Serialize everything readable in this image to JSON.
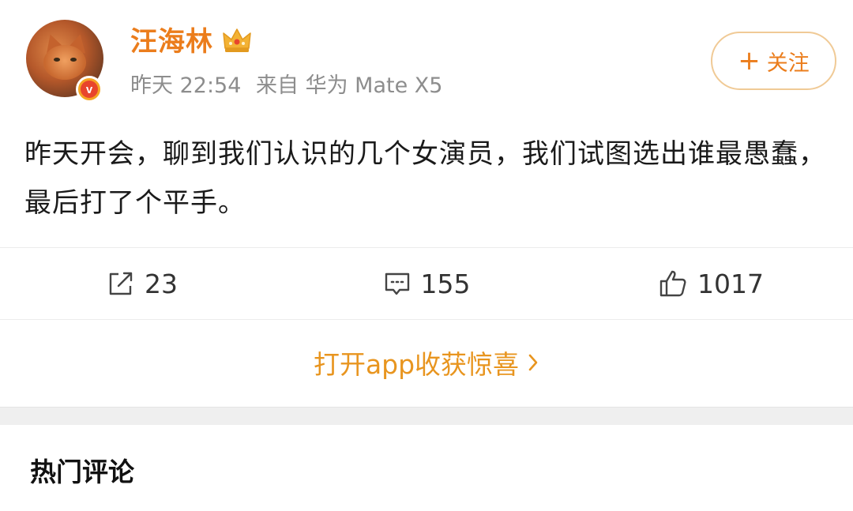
{
  "user": {
    "name": "汪海林",
    "badge_letter": "v"
  },
  "meta": {
    "time": "昨天 22:54",
    "source": "来自 华为 Mate X5"
  },
  "follow": {
    "label": "关注"
  },
  "post": {
    "text": "昨天开会，聊到我们认识的几个女演员，我们试图选出谁最愚蠢，最后打了个平手。"
  },
  "actions": {
    "repost_count": "23",
    "comment_count": "155",
    "like_count": "1017"
  },
  "open_app": {
    "label": "打开app收获惊喜"
  },
  "comments_section": {
    "title": "热门评论"
  },
  "colors": {
    "accent": "#eb7d1c",
    "meta_gray": "#8d8d8d"
  }
}
